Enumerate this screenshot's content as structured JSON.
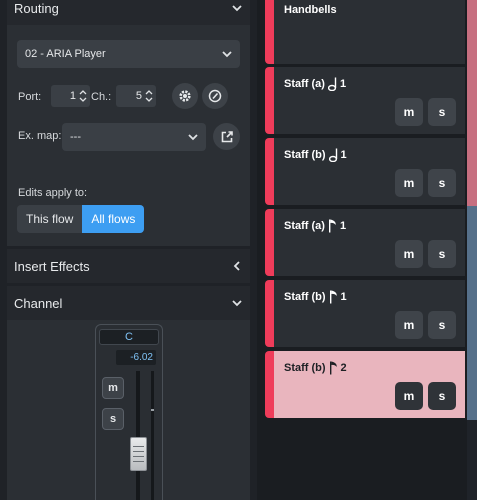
{
  "routing": {
    "title": "Routing",
    "device": "02 - ARIA Player",
    "port_label": "Port:",
    "port_value": "1",
    "ch_label": "Ch.:",
    "ch_value": "5",
    "exmap_label": "Ex. map:",
    "exmap_value": "---",
    "edits_label": "Edits apply to:",
    "this_flow": "This flow",
    "all_flows": "All flows"
  },
  "insert_effects": {
    "title": "Insert Effects"
  },
  "channel": {
    "title": "Channel",
    "pan": "C",
    "gain": "-6.02",
    "mute": "m",
    "solo": "s"
  },
  "tracks": [
    {
      "name": "Handbells",
      "num": "",
      "selected": false
    },
    {
      "name": "Staff (a)",
      "num": "1",
      "note": "half",
      "selected": false
    },
    {
      "name": "Staff (b)",
      "num": "1",
      "note": "half",
      "selected": false
    },
    {
      "name": "Staff (a)",
      "num": "1",
      "note": "flag",
      "selected": false
    },
    {
      "name": "Staff (b)",
      "num": "1",
      "note": "flag",
      "selected": false
    },
    {
      "name": "Staff (b)",
      "num": "2",
      "note": "flag",
      "selected": true
    }
  ],
  "track_buttons": {
    "mute": "m",
    "solo": "s"
  },
  "colors": {
    "accent_red": "#ef3c5a",
    "accent_blue": "#3d9ef2",
    "selected_track": "#e9b5be"
  }
}
